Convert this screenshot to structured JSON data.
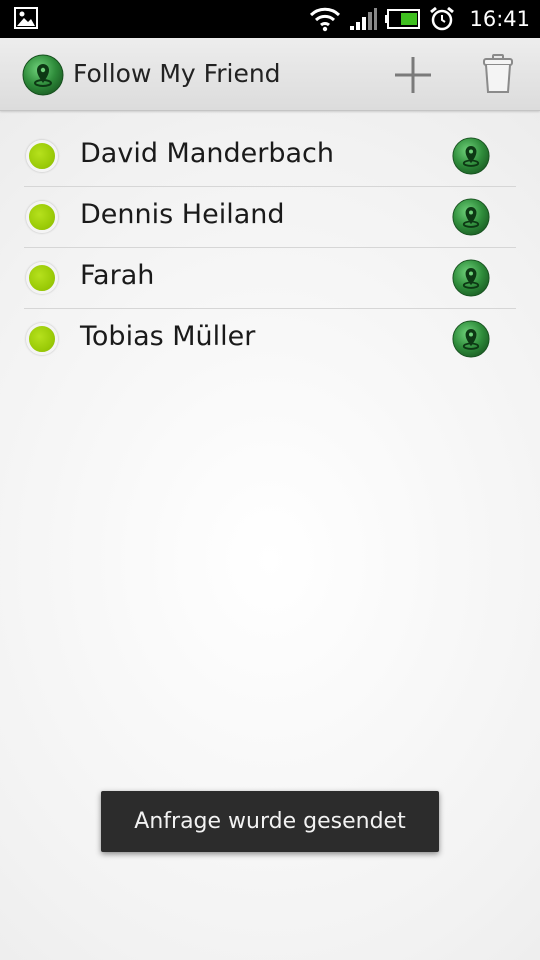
{
  "status_bar": {
    "time": "16:41",
    "icons": [
      "gallery-notification-icon",
      "wifi-icon",
      "signal-icon",
      "battery-icon",
      "alarm-icon"
    ]
  },
  "action_bar": {
    "title": "Follow My Friend",
    "logo_icon": "map-pin-logo-icon",
    "add_icon": "plus-icon",
    "delete_icon": "trash-icon"
  },
  "friends": [
    {
      "name": "David Manderbach",
      "status": "online"
    },
    {
      "name": "Dennis Heiland",
      "status": "online"
    },
    {
      "name": "Farah",
      "status": "online"
    },
    {
      "name": "Tobias Müller",
      "status": "online"
    }
  ],
  "toast": {
    "text": "Anfrage wurde gesendet"
  },
  "colors": {
    "status_online": "#9bcb08",
    "pin_green": "#2e8b3a",
    "toast_bg": "#2c2c2c",
    "status_bar_bg": "#000000"
  }
}
